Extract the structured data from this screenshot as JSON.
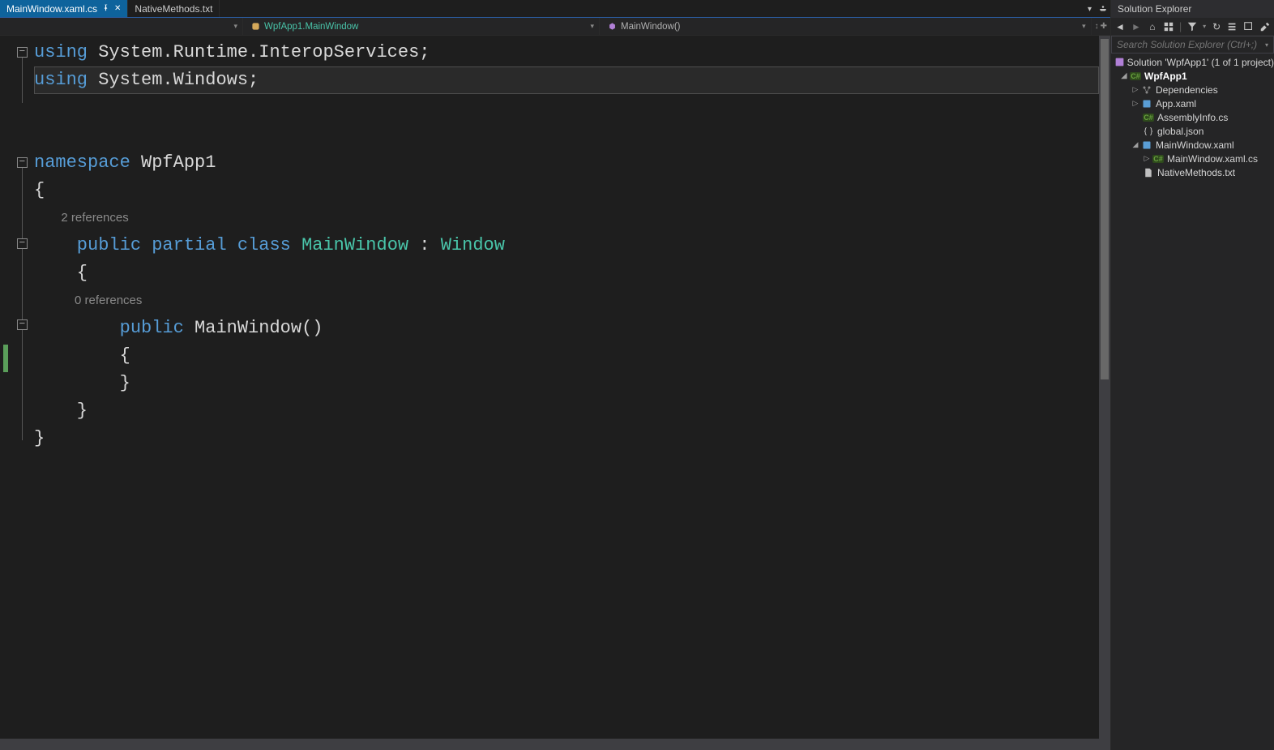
{
  "tabs": {
    "active": {
      "label": "MainWindow.xaml.cs"
    },
    "second": {
      "label": "NativeMethods.txt"
    }
  },
  "navbar": {
    "class_dropdown": "WpfApp1.MainWindow",
    "member_dropdown": "MainWindow()"
  },
  "code": {
    "l1a": "using",
    "l1b": " System.Runtime.InteropServices;",
    "l2a": "using",
    "l2b": " System.Windows;",
    "l3a": "namespace",
    "l3b": " WpfApp1",
    "l4": "{",
    "codelens1": "2 references",
    "l5a": "    public",
    "l5b": " partial",
    "l5c": " class",
    "l5d": " MainWindow",
    "l5e": " : ",
    "l5f": "Window",
    "l6": "    {",
    "codelens2": "0 references",
    "l7a": "        public",
    "l7b": " MainWindow",
    "l7c": "()",
    "l8": "        {",
    "l9": "        }",
    "l10": "    }",
    "l11": "}"
  },
  "solution_explorer": {
    "title": "Solution Explorer",
    "search_placeholder": "Search Solution Explorer (Ctrl+;)",
    "items": {
      "solution": "Solution 'WpfApp1' (1 of 1 project)",
      "project": "WpfApp1",
      "dependencies": "Dependencies",
      "appxaml": "App.xaml",
      "assemblyinfo": "AssemblyInfo.cs",
      "globaljson": "global.json",
      "mainwindowxaml": "MainWindow.xaml",
      "mainwindowxamlcs": "MainWindow.xaml.cs",
      "nativemethods": "NativeMethods.txt"
    }
  }
}
